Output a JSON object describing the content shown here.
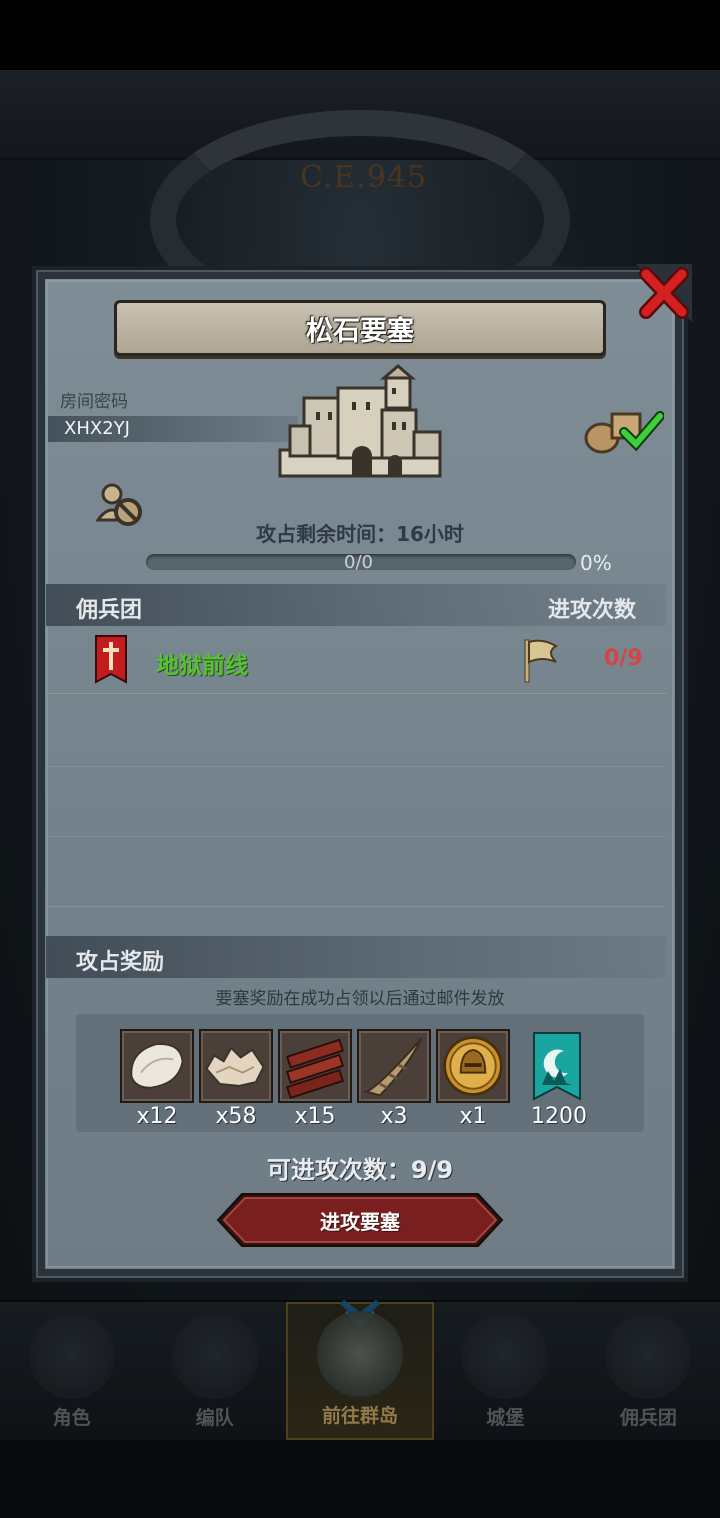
{
  "background": {
    "era": "C.E.945"
  },
  "bottom_nav": [
    {
      "label": "角色",
      "icon": "knight-icon"
    },
    {
      "label": "编队",
      "icon": "formation-icon"
    },
    {
      "label": "前往群岛",
      "icon": "islands-icon",
      "active": true
    },
    {
      "label": "城堡",
      "icon": "castle-icon"
    },
    {
      "label": "佣兵团",
      "icon": "mercenary-icon"
    }
  ],
  "modal": {
    "title": "松石要塞",
    "room": {
      "label": "房间密码",
      "code": "XHX2YJ"
    },
    "timer": {
      "label": "攻占剩余时间：",
      "value": "16小时"
    },
    "progress": {
      "count": "0/0",
      "percent_label": "0%",
      "percent": 0
    },
    "mercenary_section": {
      "title": "佣兵团",
      "right_label": "进攻次数"
    },
    "mercenaries": [
      {
        "name": "地狱前线",
        "attacks": "0/9"
      }
    ],
    "reward_section": {
      "title": "攻占奖励",
      "note": "要塞奖励在成功占领以后通过邮件发放"
    },
    "rewards": [
      {
        "icon": "hide-icon",
        "qty": "x12"
      },
      {
        "icon": "fur-icon",
        "qty": "x58"
      },
      {
        "icon": "wood-planks-icon",
        "qty": "x15"
      },
      {
        "icon": "horn-icon",
        "qty": "x3"
      },
      {
        "icon": "gold-helmet-coin-icon",
        "qty": "x1"
      },
      {
        "icon": "guild-banner-icon",
        "qty": "1200"
      }
    ],
    "attempts": {
      "label": "可进攻次数：",
      "value": "9/9"
    },
    "attack_button": "进攻要塞"
  },
  "colors": {
    "merc_name": "#55c234",
    "attacks_red": "#d54545",
    "close_red": "#d42020",
    "button_red": "#7a1f1f"
  }
}
